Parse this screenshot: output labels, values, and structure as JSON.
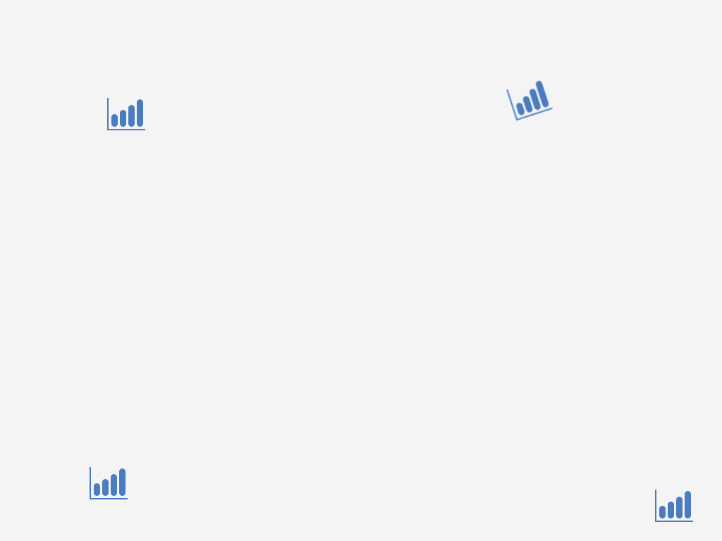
{
  "canvas": {
    "background_color": "#f4f4f4"
  },
  "icons": [
    {
      "name": "bar-chart-icon",
      "color": "#4a7cc0"
    },
    {
      "name": "bar-chart-icon",
      "color": "#4a7cc0"
    },
    {
      "name": "bar-chart-icon",
      "color": "#4a7cc0"
    },
    {
      "name": "bar-chart-icon",
      "color": "#4a7cc0"
    }
  ]
}
